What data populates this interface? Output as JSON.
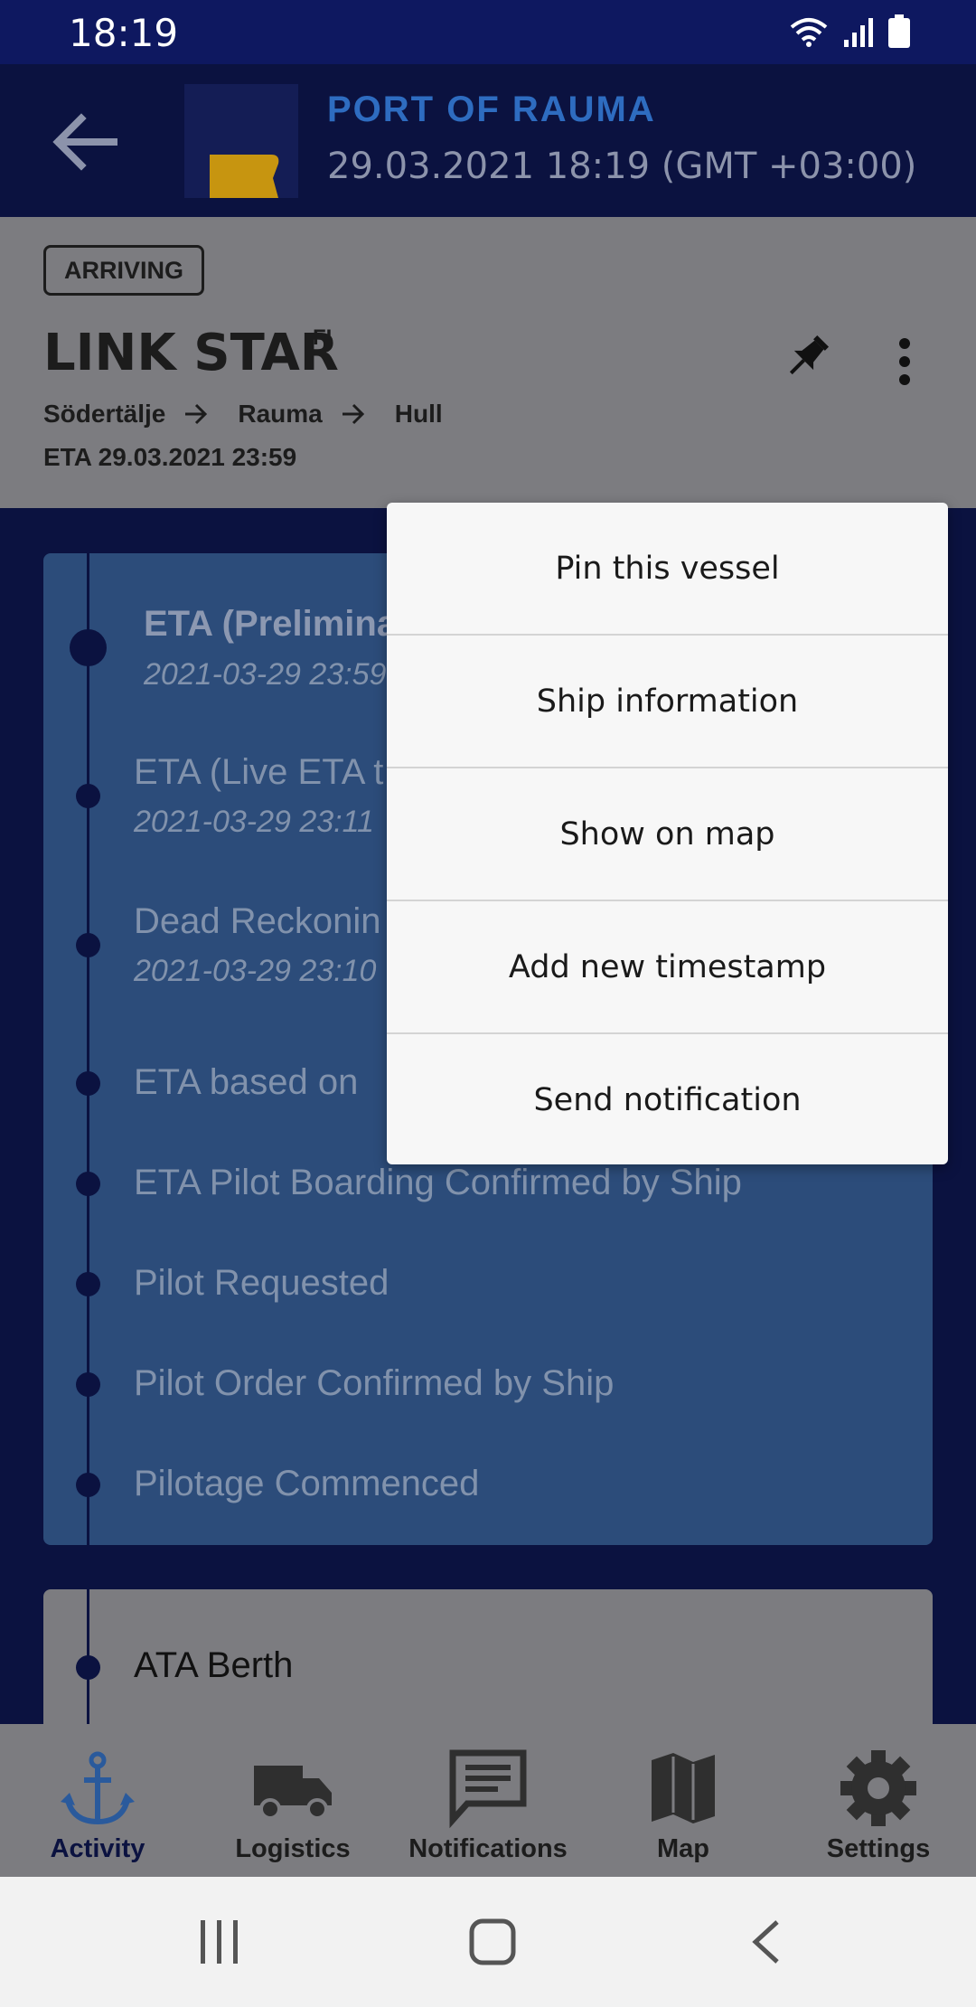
{
  "status_bar": {
    "time": "18:19"
  },
  "header": {
    "port_name": "PORT OF RAUMA",
    "datetime": "29.03.2021 18:19 (GMT +03:00)"
  },
  "vessel": {
    "status": "ARRIVING",
    "name": "LINK STAR",
    "flag": "FI",
    "route": [
      "Södertälje",
      "Rauma",
      "Hull"
    ],
    "eta": "ETA 29.03.2021 23:59"
  },
  "timeline": [
    {
      "title": "ETA (Prelimina",
      "subtitle": "2021-03-29 23:59"
    },
    {
      "title": "ETA (Live ETA t",
      "subtitle": "2021-03-29 23:11"
    },
    {
      "title": "Dead Reckonin",
      "subtitle": "2021-03-29 23:10"
    },
    {
      "title": "ETA based on"
    },
    {
      "title": "ETA Pilot Boarding Confirmed by Ship"
    },
    {
      "title": "Pilot Requested"
    },
    {
      "title": "Pilot Order Confirmed by Ship"
    },
    {
      "title": "Pilotage Commenced"
    }
  ],
  "berth": {
    "title": "ATA Berth"
  },
  "menu": {
    "items": [
      "Pin this vessel",
      "Ship information",
      "Show on map",
      "Add new timestamp",
      "Send notification"
    ]
  },
  "bottom_nav": {
    "items": [
      "Activity",
      "Logistics",
      "Notifications",
      "Map",
      "Settings"
    ],
    "active": "Activity"
  },
  "colors": {
    "accent": "#2e6cc0",
    "navy": "#0b1240",
    "timeline_card": "#2c4c7a",
    "dim_gray": "#7c7c80"
  }
}
